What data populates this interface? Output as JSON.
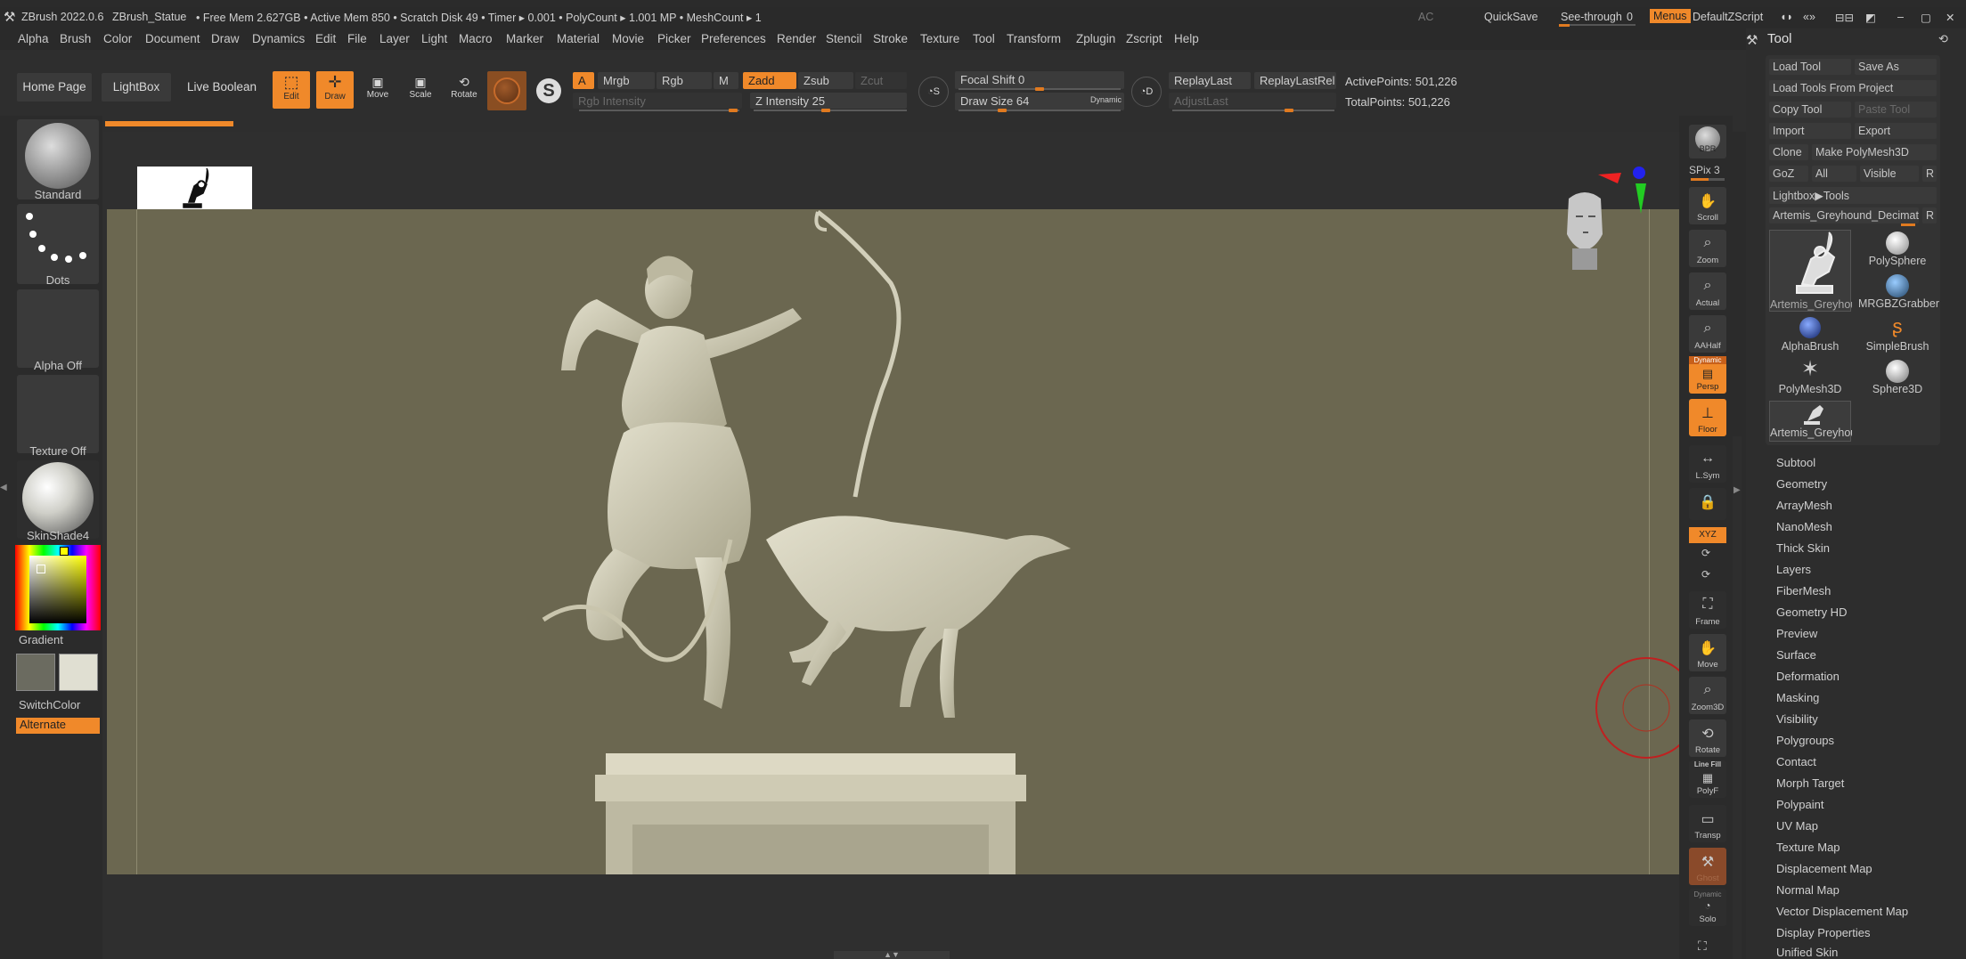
{
  "titlebar": {
    "app": "ZBrush 2022.0.6",
    "project": "ZBrush_Statue",
    "stats": "• Free Mem 2.627GB • Active Mem 850 • Scratch Disk 49 •  Timer ▸ 0.001 • PolyCount ▸ 1.001 MP  • MeshCount ▸ 1",
    "ac": "AC",
    "quicksave": "QuickSave",
    "see_through_label": "See-through",
    "see_through_value": "0",
    "menus": "Menus",
    "default_zscript": "DefaultZScript"
  },
  "menubar": [
    "Alpha",
    "Brush",
    "Color",
    "Document",
    "Draw",
    "Dynamics",
    "Edit",
    "File",
    "Layer",
    "Light",
    "Macro",
    "Marker",
    "Material",
    "Movie",
    "Picker",
    "Preferences",
    "Render",
    "Stencil",
    "Stroke",
    "Texture",
    "Tool",
    "Transform",
    "Zplugin",
    "Zscript",
    "Help"
  ],
  "toolbar": {
    "home_page": "Home Page",
    "lightbox": "LightBox",
    "live_boolean": "Live Boolean",
    "edit": "Edit",
    "draw": "Draw",
    "move": "Move",
    "scale": "Scale",
    "rotate": "Rotate",
    "a": "A",
    "mrgb": "Mrgb",
    "rgb": "Rgb",
    "m": "M",
    "zadd": "Zadd",
    "zsub": "Zsub",
    "zcut": "Zcut",
    "rgb_intensity": "Rgb Intensity",
    "z_intensity_label": "Z Intensity",
    "z_intensity_value": "25",
    "focal_shift_label": "Focal Shift",
    "focal_shift_value": "0",
    "draw_size_label": "Draw Size",
    "draw_size_value": "64",
    "dynamic": "Dynamic",
    "replay_last": "ReplayLast",
    "replay_last_rel": "ReplayLastRel",
    "adjust_last": "AdjustLast",
    "active_points": "ActivePoints: 501,226",
    "total_points": "TotalPoints: 501,226"
  },
  "leftshelf": {
    "brush": "Standard",
    "stroke": "Dots",
    "alpha": "Alpha Off",
    "texture": "Texture Off",
    "material": "SkinShade4",
    "gradient": "Gradient",
    "switch_color": "SwitchColor",
    "alternate": "Alternate"
  },
  "rightshelf": {
    "bpr": "BPR",
    "spix_label": "SPix",
    "spix_value": "3",
    "scroll": "Scroll",
    "zoom": "Zoom",
    "actual": "Actual",
    "aahalf": "AAHalf",
    "dynamic": "Dynamic",
    "persp": "Persp",
    "floor": "Floor",
    "lsym": "L.Sym",
    "xyz": "XYZ",
    "frame": "Frame",
    "move": "Move",
    "zoom3d": "Zoom3D",
    "rotate": "Rotate",
    "line_fill": "Line Fill",
    "polyf": "PolyF",
    "transp": "Transp",
    "ghost": "Ghost",
    "dynamic2": "Dynamic",
    "solo": "Solo"
  },
  "toolpalette": {
    "title": "Tool",
    "load_tool": "Load Tool",
    "save_as": "Save As",
    "load_tools_from_project": "Load Tools From Project",
    "copy_tool": "Copy Tool",
    "paste_tool": "Paste Tool",
    "import": "Import",
    "export": "Export",
    "clone": "Clone",
    "make_polymesh3d": "Make PolyMesh3D",
    "goz": "GoZ",
    "all": "All",
    "visible": "Visible",
    "r": "R",
    "lightbox_tools": "Lightbox▶Tools",
    "current_tool": "Artemis_Greyhound_Decimat",
    "r2": "R",
    "thumbs": [
      "Artemis_Greyhou",
      "PolySphere",
      "MRGBZGrabber",
      "AlphaBrush",
      "SimpleBrush",
      "PolyMesh3D",
      "Sphere3D",
      "Artemis_Greyhou"
    ],
    "subpalettes": [
      "Subtool",
      "Geometry",
      "ArrayMesh",
      "NanoMesh",
      "Thick Skin",
      "Layers",
      "FiberMesh",
      "Geometry HD",
      "Preview",
      "Surface",
      "Deformation",
      "Masking",
      "Visibility",
      "Polygroups",
      "Contact",
      "Morph Target",
      "Polypaint",
      "UV Map",
      "Texture Map",
      "Displacement Map",
      "Normal Map",
      "Vector Displacement Map",
      "Display Properties",
      "Unified Skin"
    ]
  },
  "colors": {
    "accent": "#f0892a",
    "bg": "#2b2b2b",
    "canvas": "#6b6750",
    "statue": "#cfcbb4"
  }
}
